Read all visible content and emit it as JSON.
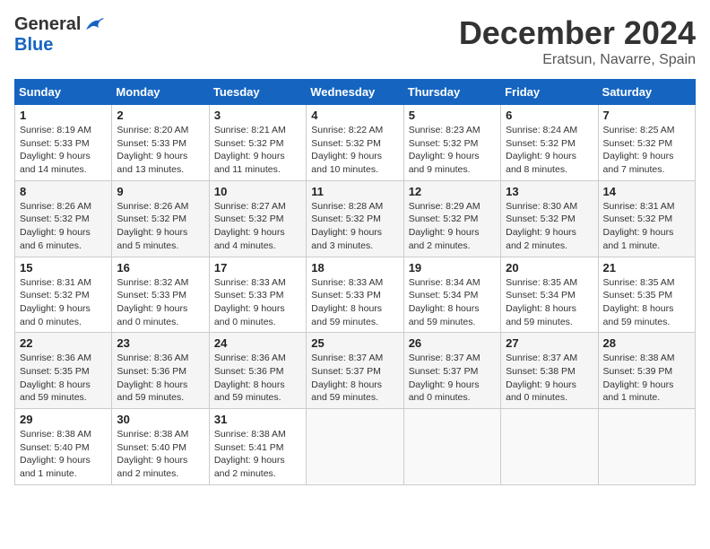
{
  "header": {
    "logo_general": "General",
    "logo_blue": "Blue",
    "month": "December 2024",
    "location": "Eratsun, Navarre, Spain"
  },
  "weekdays": [
    "Sunday",
    "Monday",
    "Tuesday",
    "Wednesday",
    "Thursday",
    "Friday",
    "Saturday"
  ],
  "weeks": [
    [
      {
        "day": "1",
        "sunrise": "Sunrise: 8:19 AM",
        "sunset": "Sunset: 5:33 PM",
        "daylight": "Daylight: 9 hours and 14 minutes."
      },
      {
        "day": "2",
        "sunrise": "Sunrise: 8:20 AM",
        "sunset": "Sunset: 5:33 PM",
        "daylight": "Daylight: 9 hours and 13 minutes."
      },
      {
        "day": "3",
        "sunrise": "Sunrise: 8:21 AM",
        "sunset": "Sunset: 5:32 PM",
        "daylight": "Daylight: 9 hours and 11 minutes."
      },
      {
        "day": "4",
        "sunrise": "Sunrise: 8:22 AM",
        "sunset": "Sunset: 5:32 PM",
        "daylight": "Daylight: 9 hours and 10 minutes."
      },
      {
        "day": "5",
        "sunrise": "Sunrise: 8:23 AM",
        "sunset": "Sunset: 5:32 PM",
        "daylight": "Daylight: 9 hours and 9 minutes."
      },
      {
        "day": "6",
        "sunrise": "Sunrise: 8:24 AM",
        "sunset": "Sunset: 5:32 PM",
        "daylight": "Daylight: 9 hours and 8 minutes."
      },
      {
        "day": "7",
        "sunrise": "Sunrise: 8:25 AM",
        "sunset": "Sunset: 5:32 PM",
        "daylight": "Daylight: 9 hours and 7 minutes."
      }
    ],
    [
      {
        "day": "8",
        "sunrise": "Sunrise: 8:26 AM",
        "sunset": "Sunset: 5:32 PM",
        "daylight": "Daylight: 9 hours and 6 minutes."
      },
      {
        "day": "9",
        "sunrise": "Sunrise: 8:26 AM",
        "sunset": "Sunset: 5:32 PM",
        "daylight": "Daylight: 9 hours and 5 minutes."
      },
      {
        "day": "10",
        "sunrise": "Sunrise: 8:27 AM",
        "sunset": "Sunset: 5:32 PM",
        "daylight": "Daylight: 9 hours and 4 minutes."
      },
      {
        "day": "11",
        "sunrise": "Sunrise: 8:28 AM",
        "sunset": "Sunset: 5:32 PM",
        "daylight": "Daylight: 9 hours and 3 minutes."
      },
      {
        "day": "12",
        "sunrise": "Sunrise: 8:29 AM",
        "sunset": "Sunset: 5:32 PM",
        "daylight": "Daylight: 9 hours and 2 minutes."
      },
      {
        "day": "13",
        "sunrise": "Sunrise: 8:30 AM",
        "sunset": "Sunset: 5:32 PM",
        "daylight": "Daylight: 9 hours and 2 minutes."
      },
      {
        "day": "14",
        "sunrise": "Sunrise: 8:31 AM",
        "sunset": "Sunset: 5:32 PM",
        "daylight": "Daylight: 9 hours and 1 minute."
      }
    ],
    [
      {
        "day": "15",
        "sunrise": "Sunrise: 8:31 AM",
        "sunset": "Sunset: 5:32 PM",
        "daylight": "Daylight: 9 hours and 0 minutes."
      },
      {
        "day": "16",
        "sunrise": "Sunrise: 8:32 AM",
        "sunset": "Sunset: 5:33 PM",
        "daylight": "Daylight: 9 hours and 0 minutes."
      },
      {
        "day": "17",
        "sunrise": "Sunrise: 8:33 AM",
        "sunset": "Sunset: 5:33 PM",
        "daylight": "Daylight: 9 hours and 0 minutes."
      },
      {
        "day": "18",
        "sunrise": "Sunrise: 8:33 AM",
        "sunset": "Sunset: 5:33 PM",
        "daylight": "Daylight: 8 hours and 59 minutes."
      },
      {
        "day": "19",
        "sunrise": "Sunrise: 8:34 AM",
        "sunset": "Sunset: 5:34 PM",
        "daylight": "Daylight: 8 hours and 59 minutes."
      },
      {
        "day": "20",
        "sunrise": "Sunrise: 8:35 AM",
        "sunset": "Sunset: 5:34 PM",
        "daylight": "Daylight: 8 hours and 59 minutes."
      },
      {
        "day": "21",
        "sunrise": "Sunrise: 8:35 AM",
        "sunset": "Sunset: 5:35 PM",
        "daylight": "Daylight: 8 hours and 59 minutes."
      }
    ],
    [
      {
        "day": "22",
        "sunrise": "Sunrise: 8:36 AM",
        "sunset": "Sunset: 5:35 PM",
        "daylight": "Daylight: 8 hours and 59 minutes."
      },
      {
        "day": "23",
        "sunrise": "Sunrise: 8:36 AM",
        "sunset": "Sunset: 5:36 PM",
        "daylight": "Daylight: 8 hours and 59 minutes."
      },
      {
        "day": "24",
        "sunrise": "Sunrise: 8:36 AM",
        "sunset": "Sunset: 5:36 PM",
        "daylight": "Daylight: 8 hours and 59 minutes."
      },
      {
        "day": "25",
        "sunrise": "Sunrise: 8:37 AM",
        "sunset": "Sunset: 5:37 PM",
        "daylight": "Daylight: 8 hours and 59 minutes."
      },
      {
        "day": "26",
        "sunrise": "Sunrise: 8:37 AM",
        "sunset": "Sunset: 5:37 PM",
        "daylight": "Daylight: 9 hours and 0 minutes."
      },
      {
        "day": "27",
        "sunrise": "Sunrise: 8:37 AM",
        "sunset": "Sunset: 5:38 PM",
        "daylight": "Daylight: 9 hours and 0 minutes."
      },
      {
        "day": "28",
        "sunrise": "Sunrise: 8:38 AM",
        "sunset": "Sunset: 5:39 PM",
        "daylight": "Daylight: 9 hours and 1 minute."
      }
    ],
    [
      {
        "day": "29",
        "sunrise": "Sunrise: 8:38 AM",
        "sunset": "Sunset: 5:40 PM",
        "daylight": "Daylight: 9 hours and 1 minute."
      },
      {
        "day": "30",
        "sunrise": "Sunrise: 8:38 AM",
        "sunset": "Sunset: 5:40 PM",
        "daylight": "Daylight: 9 hours and 2 minutes."
      },
      {
        "day": "31",
        "sunrise": "Sunrise: 8:38 AM",
        "sunset": "Sunset: 5:41 PM",
        "daylight": "Daylight: 9 hours and 2 minutes."
      },
      null,
      null,
      null,
      null
    ]
  ]
}
